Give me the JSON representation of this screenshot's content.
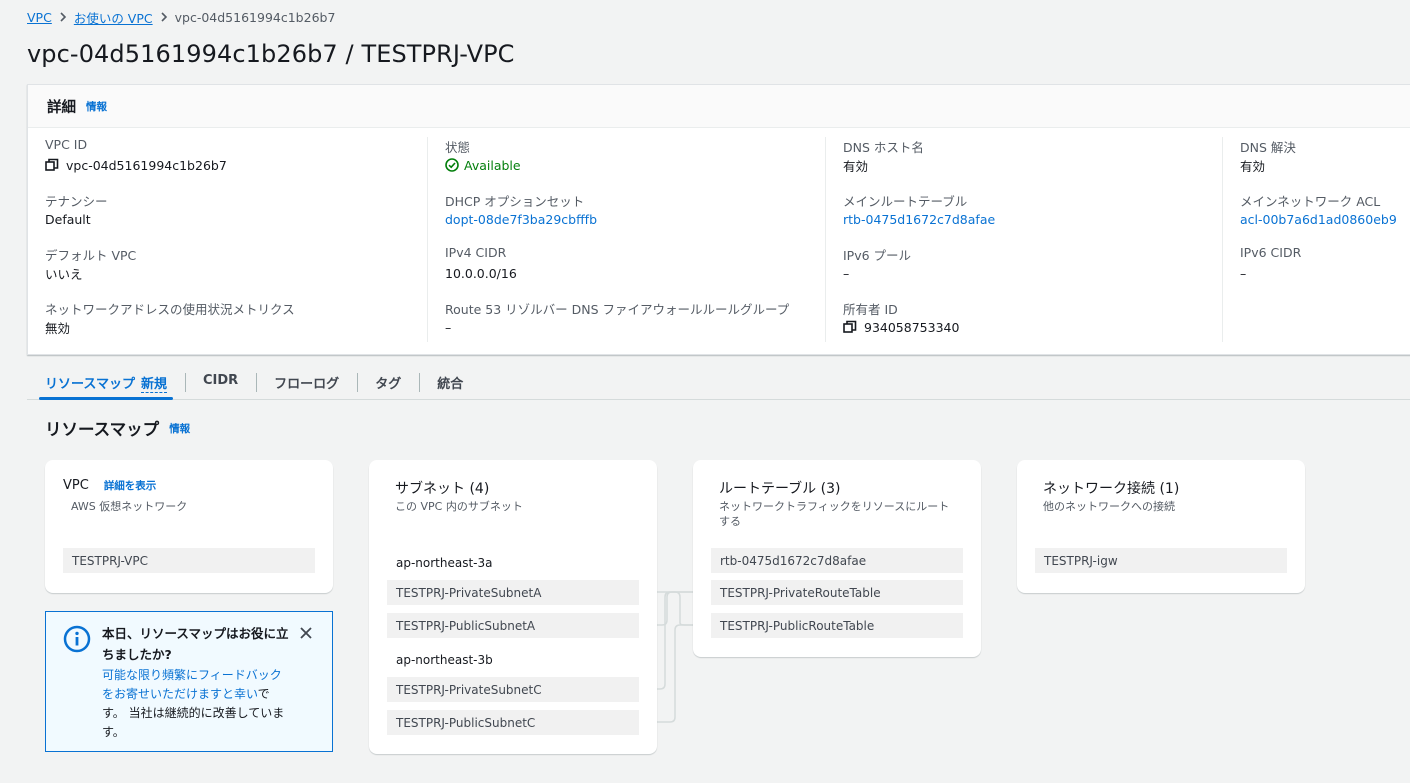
{
  "breadcrumb": {
    "items": [
      "VPC",
      "お使いの VPC"
    ],
    "current": "vpc-04d5161994c1b26b7"
  },
  "page_title": "vpc-04d5161994c1b26b7 / TESTPRJ-VPC",
  "details": {
    "title": "詳細",
    "info": "情報",
    "columns": [
      [
        {
          "label": "VPC ID",
          "value": "vpc-04d5161994c1b26b7",
          "kind": "copy"
        },
        {
          "label": "テナンシー",
          "value": "Default"
        },
        {
          "label": "デフォルト VPC",
          "value": "いいえ"
        },
        {
          "label": "ネットワークアドレスの使用状況メトリクス",
          "value": "無効"
        }
      ],
      [
        {
          "label": "状態",
          "value": "Available",
          "kind": "status"
        },
        {
          "label": "DHCP オプションセット",
          "value": "dopt-08de7f3ba29cbfffb",
          "kind": "link"
        },
        {
          "label": "IPv4 CIDR",
          "value": "10.0.0.0/16"
        },
        {
          "label": "Route 53 リゾルバー DNS ファイアウォールルールグループ",
          "value": "–"
        }
      ],
      [
        {
          "label": "DNS ホスト名",
          "value": "有効"
        },
        {
          "label": "メインルートテーブル",
          "value": "rtb-0475d1672c7d8afae",
          "kind": "link"
        },
        {
          "label": "IPv6 プール",
          "value": "–"
        },
        {
          "label": "所有者 ID",
          "value": "934058753340",
          "kind": "copy"
        }
      ],
      [
        {
          "label": "DNS 解決",
          "value": "有効"
        },
        {
          "label": "メインネットワーク ACL",
          "value": "acl-00b7a6d1ad0860eb9",
          "kind": "link"
        },
        {
          "label": "IPv6 CIDR",
          "value": "–"
        }
      ]
    ]
  },
  "tabs": [
    {
      "label": "リソースマップ",
      "badge": "新規",
      "active": true
    },
    {
      "label": "CIDR"
    },
    {
      "label": "フローログ"
    },
    {
      "label": "タグ"
    },
    {
      "label": "統合"
    }
  ],
  "resource_map": {
    "title": "リソースマップ",
    "info": "情報",
    "vpc": {
      "title": "VPC",
      "detail_link": "詳細を表示",
      "subtitle": "AWS 仮想ネットワーク",
      "name": "TESTPRJ-VPC"
    },
    "subnets": {
      "title": "サブネット (4)",
      "subtitle": "この VPC 内のサブネット",
      "az_a": "ap-northeast-3a",
      "az_b": "ap-northeast-3b",
      "items": [
        "TESTPRJ-PrivateSubnetA",
        "TESTPRJ-PublicSubnetA",
        "TESTPRJ-PrivateSubnetC",
        "TESTPRJ-PublicSubnetC"
      ]
    },
    "route_tables": {
      "title": "ルートテーブル (3)",
      "subtitle": "ネットワークトラフィックをリソースにルートする",
      "items": [
        "rtb-0475d1672c7d8afae",
        "TESTPRJ-PrivateRouteTable",
        "TESTPRJ-PublicRouteTable"
      ]
    },
    "connections": {
      "title": "ネットワーク接続 (1)",
      "subtitle": "他のネットワークへの接続",
      "items": [
        "TESTPRJ-igw"
      ]
    }
  },
  "feedback": {
    "title": "本日、リソースマップはお役に立ちましたか?",
    "body_link": "可能な限り頻繁にフィードバックをお寄せいただけますと幸い",
    "body_rest": "です。 当社は継続的に改善しています。"
  },
  "icons": {
    "copy": "copy-icon",
    "status": "status-positive-icon",
    "info": "info-circle-icon",
    "close": "close-icon",
    "chevron": "chevron-right-icon"
  },
  "colors": {
    "link": "#0972d3",
    "success": "#037f0c",
    "feedback_bg": "#f1faff"
  }
}
